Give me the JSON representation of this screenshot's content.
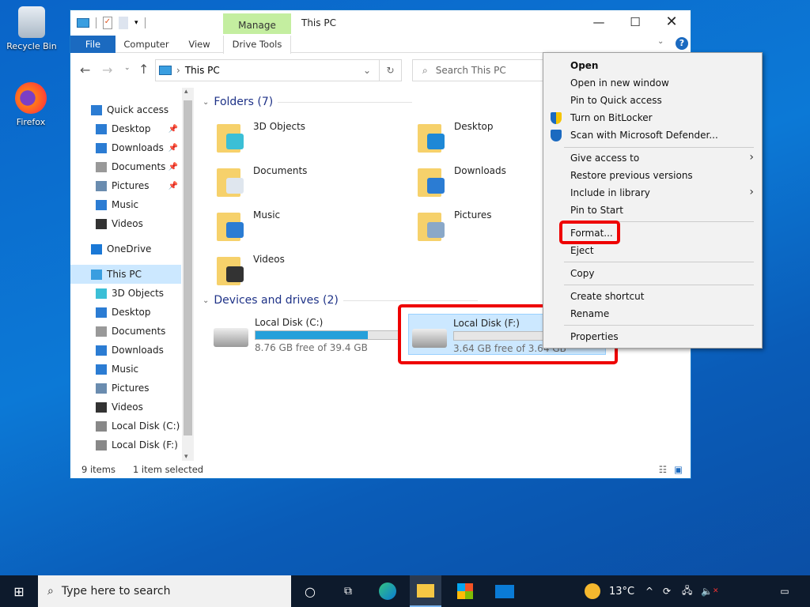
{
  "desktop": {
    "icons": [
      {
        "label": "Recycle Bin"
      },
      {
        "label": "Firefox"
      }
    ]
  },
  "window": {
    "title": "This PC",
    "manage_tab": "Manage",
    "tabs": [
      "File",
      "Computer",
      "View",
      "Drive Tools"
    ],
    "address": "This PC",
    "search_placeholder": "Search This PC",
    "nav": [
      {
        "label": "Quick access",
        "icon": "star-icon",
        "color": "#2b7cd3"
      },
      {
        "label": "Desktop",
        "icon": "desktop-icon",
        "color": "#2b7cd3",
        "pinned": true
      },
      {
        "label": "Downloads",
        "icon": "download-icon",
        "color": "#2b7cd3",
        "pinned": true
      },
      {
        "label": "Documents",
        "icon": "document-icon",
        "color": "#999",
        "pinned": true
      },
      {
        "label": "Pictures",
        "icon": "picture-icon",
        "color": "#6a8caf",
        "pinned": true
      },
      {
        "label": "Music",
        "icon": "music-icon",
        "color": "#2b7cd3"
      },
      {
        "label": "Videos",
        "icon": "video-icon",
        "color": "#333"
      },
      {
        "label": "OneDrive",
        "icon": "cloud-icon",
        "color": "#1a78d6"
      },
      {
        "label": "This PC",
        "icon": "computer-icon",
        "color": "#3a9ee0",
        "selected": true
      },
      {
        "label": "3D Objects",
        "icon": "cube-icon",
        "color": "#3bbfd6"
      },
      {
        "label": "Desktop",
        "icon": "desktop-icon",
        "color": "#2b7cd3"
      },
      {
        "label": "Documents",
        "icon": "document-icon",
        "color": "#999"
      },
      {
        "label": "Downloads",
        "icon": "download-icon",
        "color": "#2b7cd3"
      },
      {
        "label": "Music",
        "icon": "music-icon",
        "color": "#2b7cd3"
      },
      {
        "label": "Pictures",
        "icon": "picture-icon",
        "color": "#6a8caf"
      },
      {
        "label": "Videos",
        "icon": "video-icon",
        "color": "#333"
      },
      {
        "label": "Local Disk (C:)",
        "icon": "drive-icon",
        "color": "#888"
      },
      {
        "label": "Local Disk (F:)",
        "icon": "drive-icon",
        "color": "#888"
      }
    ],
    "folders_header": "Folders (7)",
    "folders": [
      {
        "label": "3D Objects",
        "color": "#3bbfd6"
      },
      {
        "label": "Desktop",
        "color": "#1e88d6"
      },
      {
        "label": "Documents",
        "color": "#dfe6ee"
      },
      {
        "label": "Downloads",
        "color": "#2b7cd3"
      },
      {
        "label": "Music",
        "color": "#2b7cd3"
      },
      {
        "label": "Pictures",
        "color": "#8aa8c8"
      },
      {
        "label": "Videos",
        "color": "#333"
      }
    ],
    "drives_header": "Devices and drives (2)",
    "drives": [
      {
        "label": "Local Disk (C:)",
        "free": "8.76 GB free of 39.4 GB",
        "used_fraction": 0.78
      },
      {
        "label": "Local Disk (F:)",
        "free": "3.64 GB free of 3.64 GB",
        "used_fraction": 0.0,
        "selected": true
      }
    ],
    "status": {
      "items": "9 items",
      "selected": "1 item selected"
    }
  },
  "context_menu": {
    "items": [
      "Open",
      "Open in new window",
      "Pin to Quick access",
      "Turn on BitLocker",
      "Scan with Microsoft Defender...",
      "Give access to",
      "Restore previous versions",
      "Include in library",
      "Pin to Start",
      "Format...",
      "Eject",
      "Copy",
      "Create shortcut",
      "Rename",
      "Properties"
    ],
    "highlighted": "Format..."
  },
  "taskbar": {
    "search_placeholder": "Type here to search",
    "temperature": "13°C"
  },
  "colors": {
    "highlight": "#e00000",
    "accent": "#1b6ac0",
    "manage": "#c4eea0"
  }
}
